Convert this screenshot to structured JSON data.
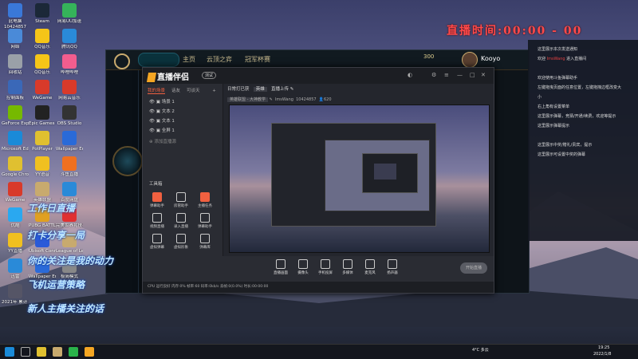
{
  "desktop": {
    "icons": [
      {
        "label": "此电脑",
        "sub": "10424857",
        "color": "#3a78d8"
      },
      {
        "label": "Steam",
        "color": "#1b2838"
      },
      {
        "label": "网易UU加速",
        "color": "#35b35a"
      },
      {
        "label": "网络",
        "color": "#4a8ad8"
      },
      {
        "label": "QQ音乐",
        "color": "#f5c518"
      },
      {
        "label": "腾讯QQ",
        "color": "#2a8ad8"
      },
      {
        "label": "回收站",
        "color": "#9aa0a8"
      },
      {
        "label": "QQ音乐",
        "color": "#f5c518"
      },
      {
        "label": "哔哩哔哩",
        "color": "#f25d8e"
      },
      {
        "label": "控制面板",
        "color": "#3a68b8"
      },
      {
        "label": "WeGame",
        "color": "#d83a2a"
      },
      {
        "label": "网易云音乐",
        "color": "#d83a2a"
      },
      {
        "label": "GeForce Experience",
        "color": "#76b900"
      },
      {
        "label": "Epic Games Launcher",
        "color": "#222"
      },
      {
        "label": "OBS Studio",
        "color": "#333"
      },
      {
        "label": "Microsoft Edge",
        "color": "#1a8ad8"
      },
      {
        "label": "PotPlayer",
        "color": "#e0c030"
      },
      {
        "label": "Wallpaper Engine",
        "color": "#2a6ad8"
      },
      {
        "label": "Google Chrome",
        "color": "#e0c030"
      },
      {
        "label": "YY语音",
        "color": "#f0c020"
      },
      {
        "label": "斗鱼直播",
        "color": "#f07020"
      },
      {
        "label": "WeGame",
        "color": "#d83a2a"
      },
      {
        "label": "英雄联盟",
        "color": "#c8aa6e"
      },
      {
        "label": "百度网盘",
        "color": "#2a8ad8"
      },
      {
        "label": "优酷",
        "color": "#2aa8f0"
      },
      {
        "label": "PUBG BATTLEGR...",
        "color": "#e0a020"
      },
      {
        "label": "完美世界竞技平台",
        "color": "#e03030"
      },
      {
        "label": "YY直播",
        "color": "#f0c020"
      },
      {
        "label": "Ubisoft Connect",
        "color": "#2a5ad8"
      },
      {
        "label": "League of Legends",
        "color": "#c8aa6e"
      },
      {
        "label": "迅雷",
        "color": "#2a8ad8"
      },
      {
        "label": "Wallpaper Engine",
        "color": "#2a6ad8"
      },
      {
        "label": "极简模式",
        "color": "#888"
      },
      {
        "label": "2021年 累计 Fi世界",
        "color": "#556"
      }
    ]
  },
  "stream_title": "直播时间:00:00 - 00",
  "game": {
    "nav": [
      "主页",
      "云顶之弈",
      "冠军杯赛"
    ],
    "coins": "300",
    "username": "Kooyo"
  },
  "chat": {
    "lines": [
      {
        "text": "这里展示本次发送通知"
      },
      {
        "text": "欢迎 ",
        "em": "ImsWang",
        "tail": " 进入直播间"
      },
      {
        "text": ""
      },
      {
        "text": "欢迎使用斗鱼弹幕助手"
      },
      {
        "text": "左键拖曳页面的任意位置，左键拖拽边框改变大"
      },
      {
        "text": "小"
      },
      {
        "text": "右上角有设置菜单"
      },
      {
        "text": "这里展示弹幕，竞猜/开通/续费，欢迎等提示"
      },
      {
        "text": "这里展示弹幕提示"
      },
      {
        "text": ""
      },
      {
        "text": "这里展示中奖/赠礼/贵宾，提示"
      },
      {
        "text": "这里展示可设置中奖的弹幕"
      }
    ]
  },
  "app": {
    "name": "直播伴侣",
    "tag": "测试",
    "tabs": [
      "我的场景",
      "话友",
      "可谈天"
    ],
    "add_label": "+",
    "scenes": [
      "场景 1",
      "文本 2",
      "文本 1",
      "全屏 1"
    ],
    "add_source": "添加直播源",
    "tools_title": "工具箱",
    "tools": [
      {
        "label": "弹幕助手",
        "color": "#f06040"
      },
      {
        "label": "房管助手",
        "color": "#ccc"
      },
      {
        "label": "主播任务",
        "color": "#f06040"
      },
      {
        "label": "视频直播",
        "color": "#ccc"
      },
      {
        "label": "录入直播",
        "color": "#ccc"
      },
      {
        "label": "弹幕助手",
        "color": "#ccc"
      },
      {
        "label": "虚拟弹幕",
        "color": "#ccc"
      },
      {
        "label": "虚拟形象",
        "color": "#ccc"
      },
      {
        "label": "弹幕库",
        "color": "#ccc"
      }
    ],
    "top_row": [
      "日常打已获",
      "英雄",
      "直播上传"
    ],
    "room_label": "英雄联盟 - 大神教学",
    "room_user": "ImsWang",
    "room_id": "10424857",
    "viewers": "620",
    "bottom_tools": [
      "直播画面",
      "摄像头",
      "手机投屏",
      "多媒体",
      "麦克风",
      "扬声器"
    ],
    "live_button": "开始直播",
    "status_text": "CPU 运行良好  内存:0%  帧率:60  码率:0kb/s  丢帧:0(0.0%)  时长:00:00:00"
  },
  "overlay_text": [
    "工作日直播",
    "打卡分享一局",
    "你的关注是我的动力",
    "飞机运营策略",
    "新人主播关注的话"
  ],
  "taskbar": {
    "weather": "4°C 多云",
    "time": "19:25",
    "date": "2022/1/8"
  }
}
